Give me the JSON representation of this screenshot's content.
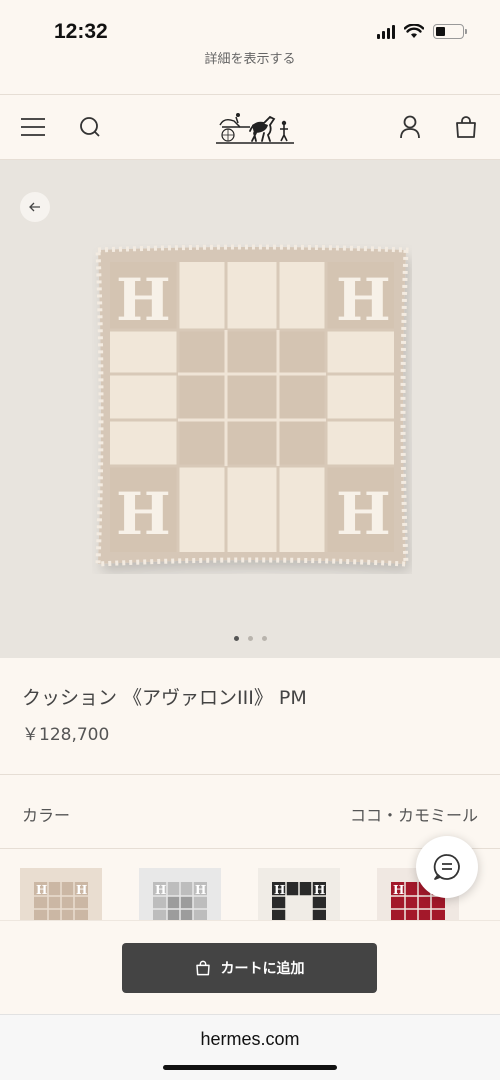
{
  "status": {
    "time": "12:32"
  },
  "top_link": "詳細を表示する",
  "product": {
    "title": "クッション 《アヴァロンIII》 PM",
    "price": "￥128,700",
    "color_label": "カラー",
    "color_value": "ココ・カモミール"
  },
  "gallery": {
    "image_count": 3,
    "active_index": 0
  },
  "swatches": [
    {
      "name": "beige",
      "bg": "#e9ddd0",
      "accent": "#cbb7a4"
    },
    {
      "name": "grey",
      "bg": "#e8e8e8",
      "accent": "#9c9c9c"
    },
    {
      "name": "black",
      "bg": "#f0ece6",
      "accent": "#2a2a2a"
    },
    {
      "name": "red",
      "bg": "#f0e8e2",
      "accent": "#a3182a"
    }
  ],
  "cart": {
    "button_label": "カートに追加"
  },
  "browser": {
    "url": "hermes.com"
  },
  "colors": {
    "cart_button": "#444444",
    "background": "#fcf7f1"
  }
}
